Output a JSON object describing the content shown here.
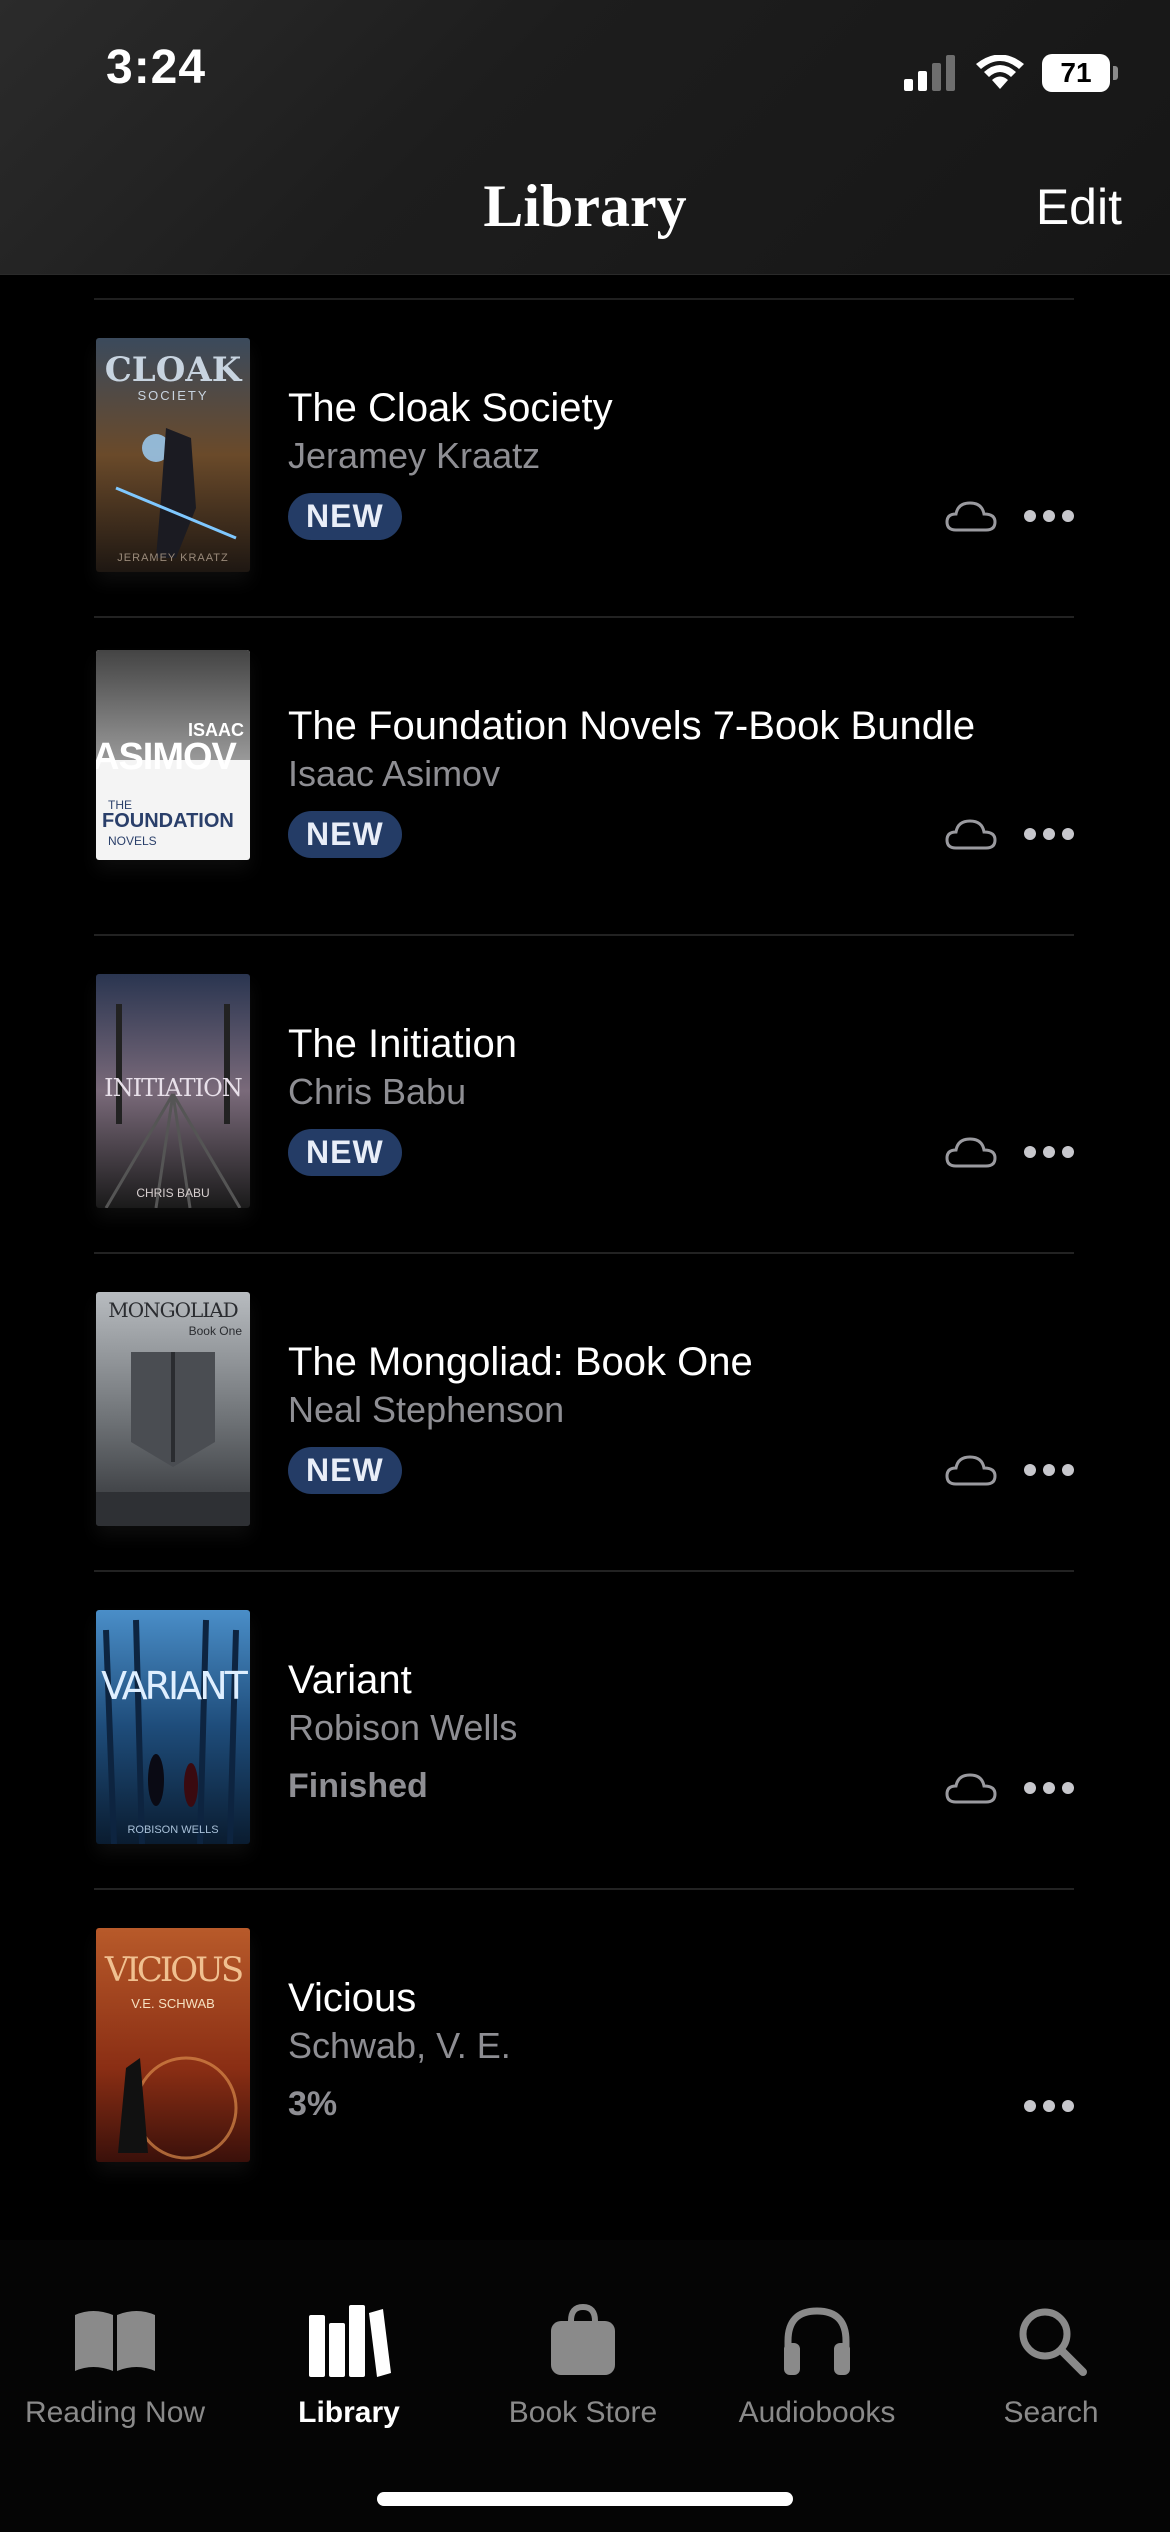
{
  "status_bar": {
    "time": "3:24",
    "battery": "71"
  },
  "header": {
    "title": "Library",
    "edit_label": "Edit"
  },
  "books": [
    {
      "title": "The Cloak Society",
      "author": "Jeramey Kraatz",
      "badge": "NEW",
      "status": "",
      "cloud": true
    },
    {
      "title": "The Foundation Novels 7-Book Bundle",
      "author": "Isaac Asimov",
      "badge": "NEW",
      "status": "",
      "cloud": true
    },
    {
      "title": "The Initiation",
      "author": "Chris Babu",
      "badge": "NEW",
      "status": "",
      "cloud": true
    },
    {
      "title": "The Mongoliad: Book One",
      "author": "Neal Stephenson",
      "badge": "NEW",
      "status": "",
      "cloud": true
    },
    {
      "title": "Variant",
      "author": "Robison Wells",
      "badge": "",
      "status": "Finished",
      "cloud": true
    },
    {
      "title": "Vicious",
      "author": "Schwab, V. E.",
      "badge": "",
      "status": "3%",
      "cloud": false
    }
  ],
  "covers": {
    "cloak": {
      "title": "CLOAK",
      "sub": "SOCIETY",
      "author": "JERAMEY KRAATZ"
    },
    "foundation": {
      "top": "ISAAC",
      "name": "ASIMOV",
      "the": "THE",
      "main": "FOUNDATION",
      "sub": "NOVELS"
    },
    "initiation": {
      "main": "INITIATION",
      "author": "CHRIS BABU"
    },
    "mongoliad": {
      "main": "MONGOLIAD",
      "sub": "Book One"
    },
    "variant": {
      "main": "VARIANT",
      "author": "ROBISON WELLS"
    },
    "vicious": {
      "main": "VICIOUS",
      "author": "V.E. SCHWAB"
    }
  },
  "tabs": [
    {
      "label": "Reading Now",
      "icon": "book-open-icon",
      "active": false
    },
    {
      "label": "Library",
      "icon": "library-icon",
      "active": true
    },
    {
      "label": "Book Store",
      "icon": "shopping-bag-icon",
      "active": false
    },
    {
      "label": "Audiobooks",
      "icon": "headphones-icon",
      "active": false
    },
    {
      "label": "Search",
      "icon": "search-icon",
      "active": false
    }
  ]
}
